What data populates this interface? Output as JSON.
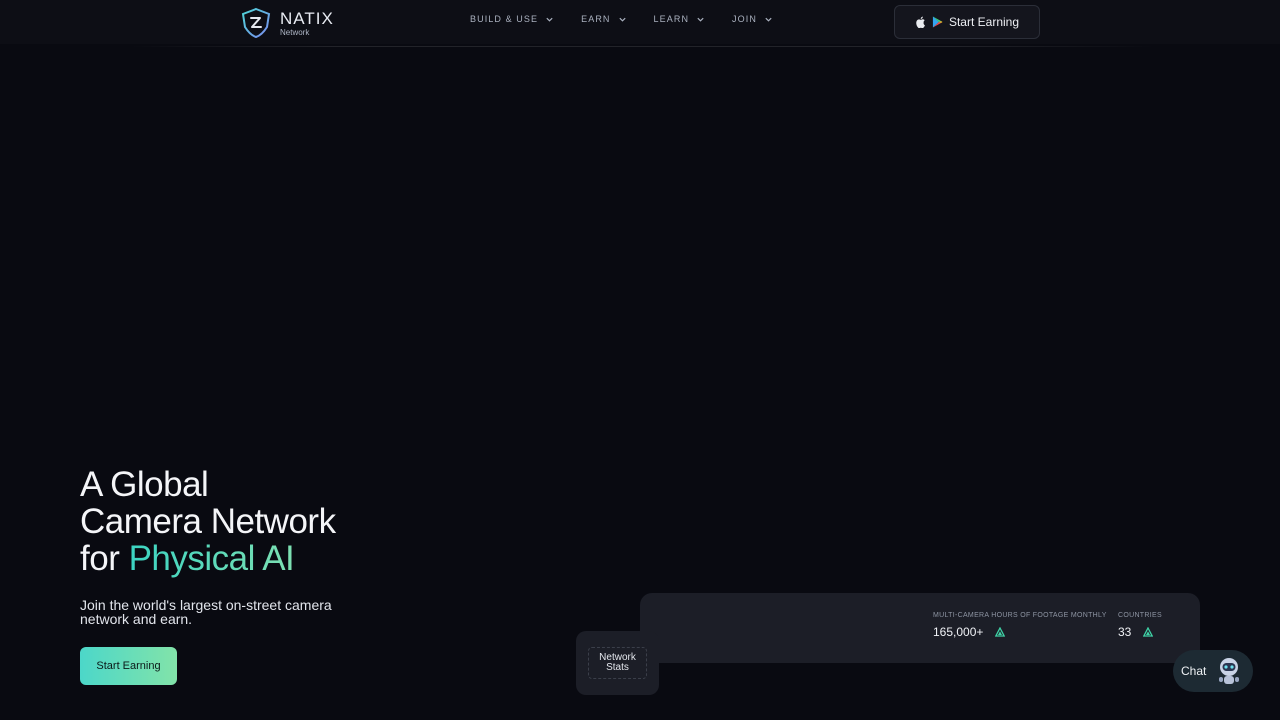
{
  "brand": {
    "name": "NATIX",
    "sub": "Network"
  },
  "nav": {
    "items": [
      {
        "label": "BUILD & USE"
      },
      {
        "label": "EARN"
      },
      {
        "label": "LEARN"
      },
      {
        "label": "JOIN"
      }
    ],
    "cta_label": "Start Earning"
  },
  "hero": {
    "title_line1": "A Global",
    "title_line2": "Camera Network",
    "title_line3_prefix": "for ",
    "title_line3_accent": "Physical AI",
    "subtitle": "Join the world's largest on-street camera network and earn.",
    "cta_label": "Start Earning"
  },
  "stats": {
    "tab_label": "Network\nStats",
    "items": [
      {
        "label": "MULTI-CAMERA HOURS OF FOOTAGE MONTHLY",
        "value": "165,000+"
      },
      {
        "label": "COUNTRIES",
        "value": "33"
      }
    ]
  },
  "chat": {
    "label": "Chat"
  },
  "colors": {
    "background": "#090a11",
    "accent_start": "#3bd4c2",
    "accent_end": "#82e3a9",
    "panel": "#1c1e27"
  },
  "icons": [
    "natix-logo-icon",
    "chevron-down-icon",
    "apple-icon",
    "google-play-icon",
    "trend-up-icon",
    "chat-bot-icon"
  ]
}
